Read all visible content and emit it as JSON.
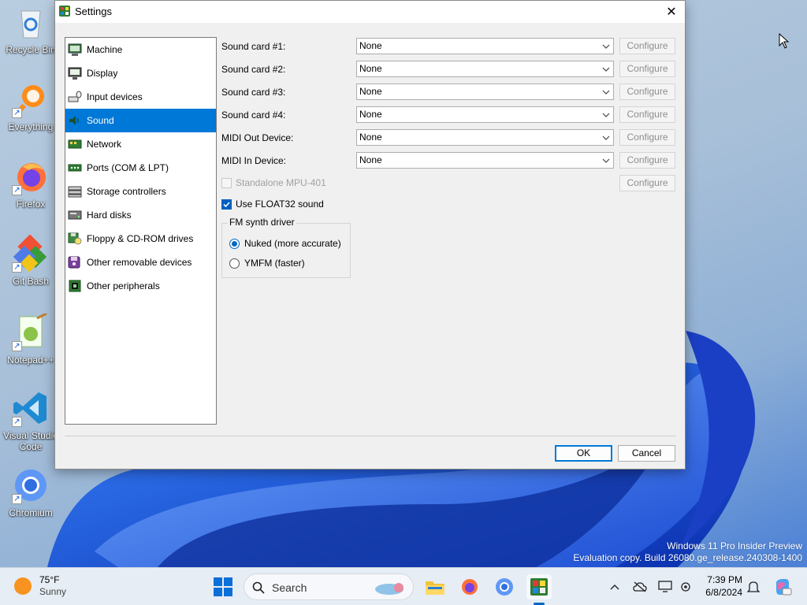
{
  "desktop": {
    "icons": [
      {
        "label": "Recycle Bin",
        "icon": "recycle-bin-icon"
      },
      {
        "label": "Everything",
        "icon": "everything-search-icon"
      },
      {
        "label": "Firefox",
        "icon": "firefox-icon"
      },
      {
        "label": "Git Bash",
        "icon": "git-bash-icon"
      },
      {
        "label": "Notepad++",
        "icon": "notepad-plus-plus-icon"
      },
      {
        "label": "Visual Studio Code",
        "icon": "vscode-icon"
      },
      {
        "label": "Chromium",
        "icon": "chromium-icon"
      }
    ],
    "watermark": {
      "line1": "Windows 11 Pro Insider Preview",
      "line2": "Evaluation copy. Build 26080.ge_release.240308-1400"
    }
  },
  "dialog": {
    "title": "Settings",
    "close_symbol": "✕",
    "nav": [
      {
        "label": "Machine",
        "icon": "machine-icon",
        "selected": false
      },
      {
        "label": "Display",
        "icon": "display-icon",
        "selected": false
      },
      {
        "label": "Input devices",
        "icon": "input-devices-icon",
        "selected": false
      },
      {
        "label": "Sound",
        "icon": "sound-icon",
        "selected": true
      },
      {
        "label": "Network",
        "icon": "network-icon",
        "selected": false
      },
      {
        "label": "Ports (COM & LPT)",
        "icon": "ports-icon",
        "selected": false
      },
      {
        "label": "Storage controllers",
        "icon": "storage-controllers-icon",
        "selected": false
      },
      {
        "label": "Hard disks",
        "icon": "hard-disks-icon",
        "selected": false
      },
      {
        "label": "Floppy & CD-ROM drives",
        "icon": "floppy-cdrom-icon",
        "selected": false
      },
      {
        "label": "Other removable devices",
        "icon": "removable-devices-icon",
        "selected": false
      },
      {
        "label": "Other peripherals",
        "icon": "peripherals-icon",
        "selected": false
      }
    ],
    "sound": {
      "rows": [
        {
          "label": "Sound card #1:",
          "value": "None",
          "configure": "Configure"
        },
        {
          "label": "Sound card #2:",
          "value": "None",
          "configure": "Configure"
        },
        {
          "label": "Sound card #3:",
          "value": "None",
          "configure": "Configure"
        },
        {
          "label": "Sound card #4:",
          "value": "None",
          "configure": "Configure"
        },
        {
          "label": "MIDI Out Device:",
          "value": "None",
          "configure": "Configure"
        },
        {
          "label": "MIDI In Device:",
          "value": "None",
          "configure": "Configure"
        }
      ],
      "standalone_mpu": {
        "label": "Standalone MPU-401",
        "checked": false,
        "enabled": false,
        "configure": "Configure"
      },
      "use_float32": {
        "label": "Use FLOAT32 sound",
        "checked": true
      },
      "fm_synth": {
        "legend": "FM synth driver",
        "options": [
          {
            "label": "Nuked (more accurate)",
            "selected": true
          },
          {
            "label": "YMFM (faster)",
            "selected": false
          }
        ]
      }
    },
    "buttons": {
      "ok": "OK",
      "cancel": "Cancel"
    }
  },
  "taskbar": {
    "weather": {
      "temp": "75°F",
      "condition": "Sunny"
    },
    "search_placeholder": "Search",
    "apps": [
      "file-explorer-icon",
      "firefox-icon",
      "chromium-icon",
      "86box-icon"
    ],
    "clock": {
      "time": "7:39 PM",
      "date": "6/8/2024"
    },
    "tray": [
      "chevron-up-icon",
      "onedrive-icon",
      "display-icon",
      "settings-icon",
      "notification-bell-icon",
      "copilot-icon"
    ]
  }
}
